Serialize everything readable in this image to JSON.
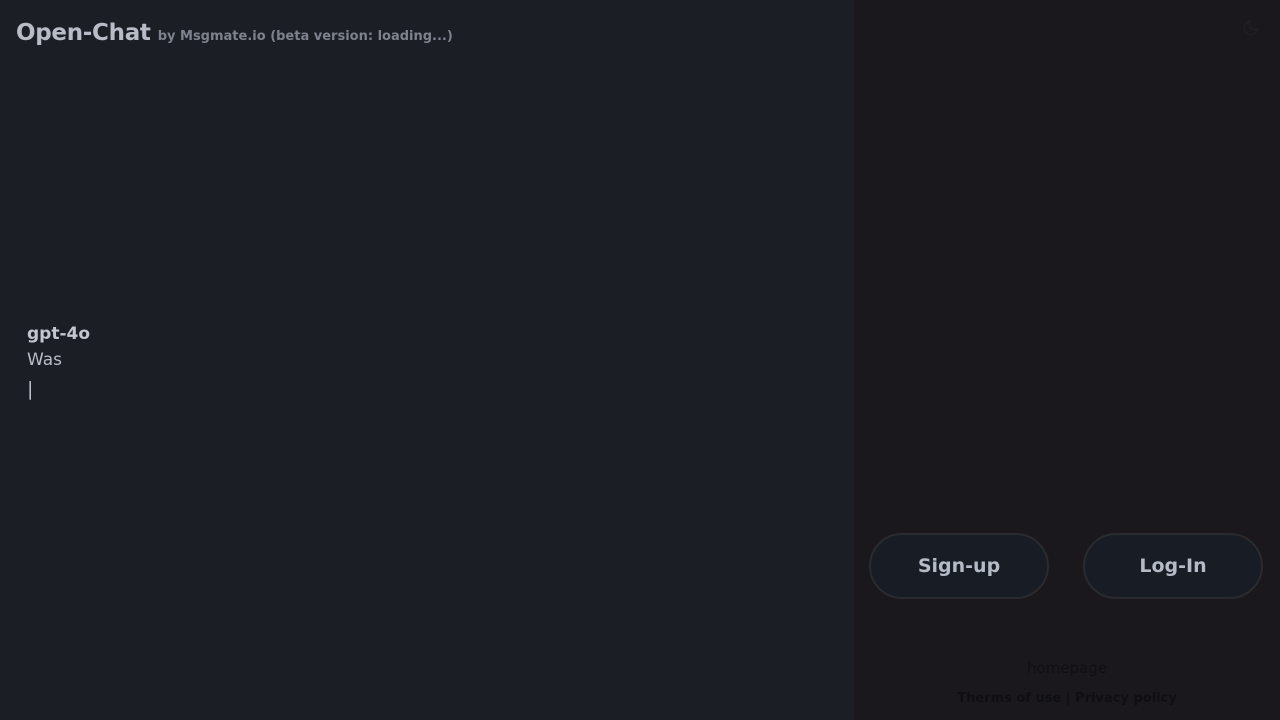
{
  "header": {
    "title": "Open-Chat",
    "subtitle": "by Msgmate.io (beta version: loading...)"
  },
  "chat": {
    "model": "gpt-4o",
    "message": "Was",
    "cursor": "|"
  },
  "sidebar": {
    "theme_icon": "moon-icon",
    "signup_label": "Sign-up",
    "login_label": "Log-In",
    "homepage_link": "homepage",
    "terms_link": "Therms of use",
    "separator": "|",
    "privacy_link": "Privacy policy"
  },
  "colors": {
    "main_bg": "#1b1e25",
    "sidebar_bg": "#1a181d",
    "button_bg": "#181c24",
    "button_border": "#2a2b2e",
    "text": "#b8bcc6"
  }
}
